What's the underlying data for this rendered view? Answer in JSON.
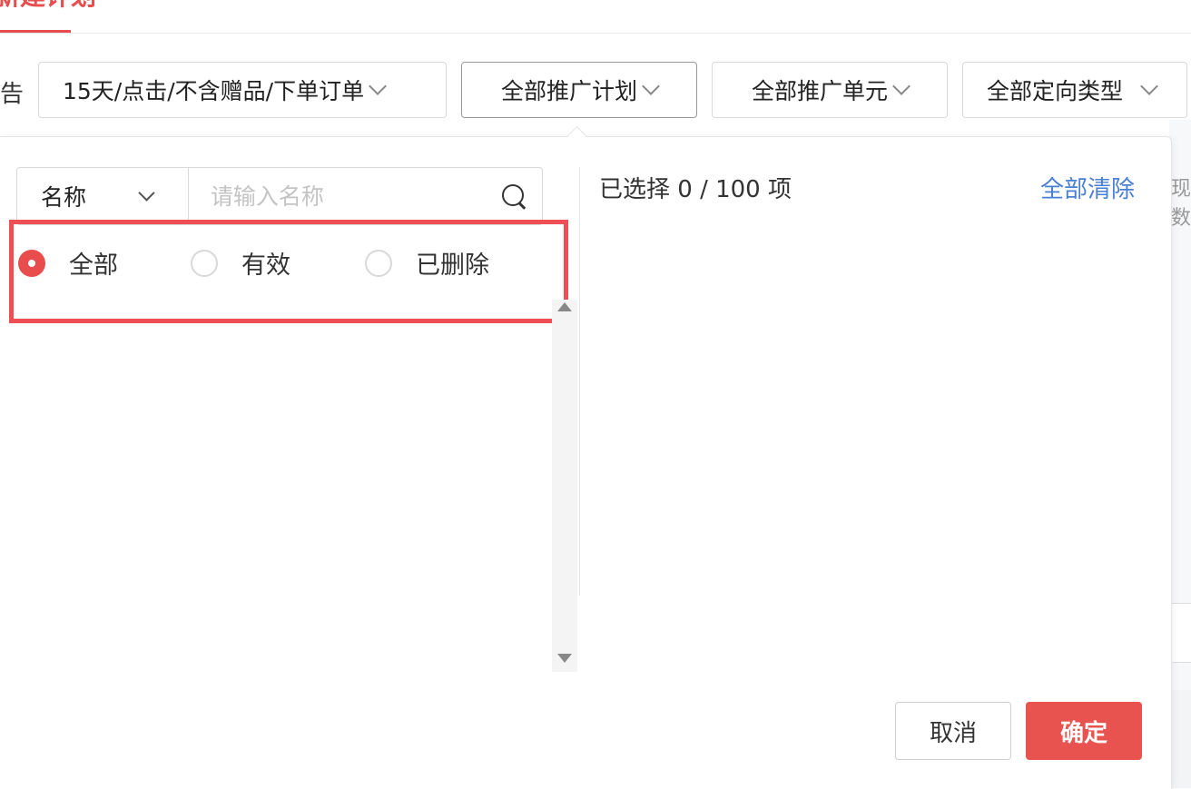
{
  "top_tab": {
    "label": "新建计划"
  },
  "filters": {
    "label": "告",
    "attribution": "15天/点击/不含赠品/下单订单",
    "plan": "全部推广计划",
    "unit": "全部推广单元",
    "target_type": "全部定向类型"
  },
  "background": {
    "right_text": "现数"
  },
  "popover": {
    "search": {
      "type_label": "名称",
      "placeholder": "请输入名称",
      "value": ""
    },
    "status_filter": {
      "options": [
        {
          "label": "全部",
          "checked": true
        },
        {
          "label": "有效",
          "checked": false
        },
        {
          "label": "已删除",
          "checked": false
        }
      ]
    },
    "selected_summary": "已选择 0 / 100 项",
    "clear_all": "全部清除",
    "footer": {
      "cancel": "取消",
      "confirm": "确定"
    }
  },
  "colors": {
    "accent": "#e84c4c",
    "highlight": "#ee4f55",
    "link": "#4a7fd6"
  }
}
